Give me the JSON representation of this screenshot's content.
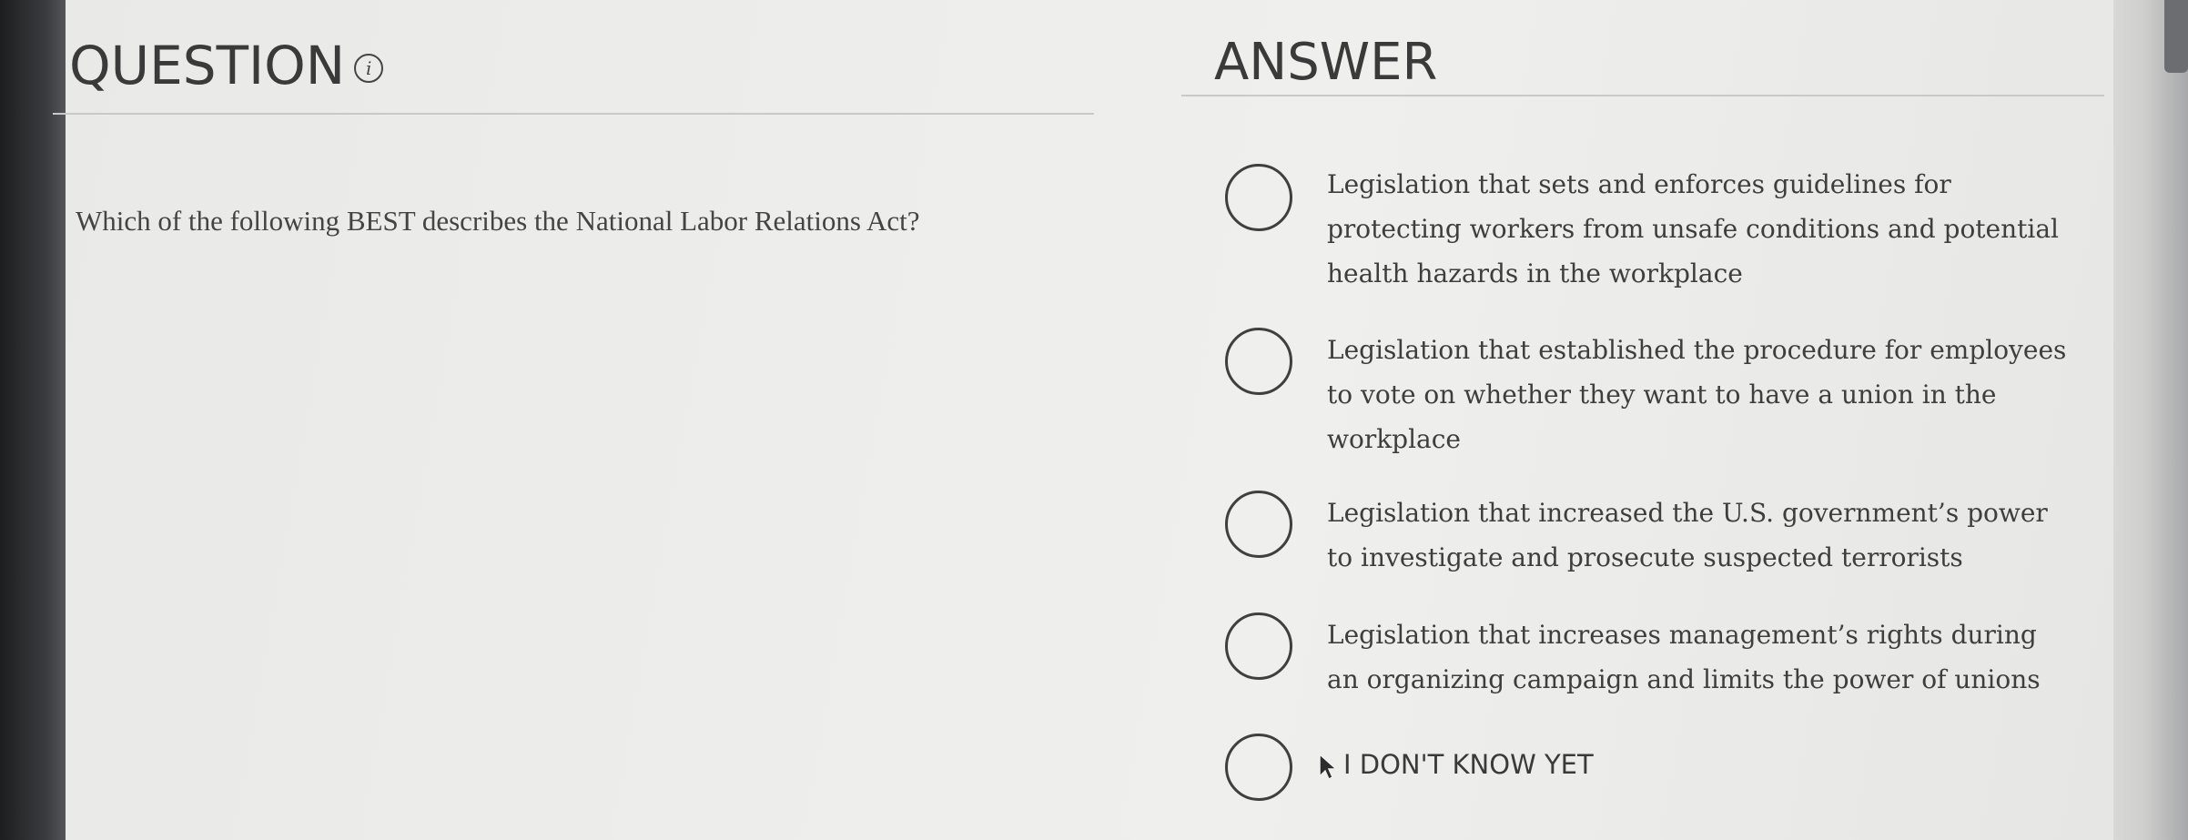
{
  "question_panel": {
    "heading": "QUESTION",
    "info_icon_glyph": "i",
    "text": "Which of the following BEST describes the National Labor Relations Act?"
  },
  "answer_panel": {
    "heading": "ANSWER",
    "options": [
      {
        "label": "Legislation that sets and enforces guidelines for protecting workers from unsafe conditions and potential health hazards in the workplace",
        "selected": false
      },
      {
        "label": "Legislation that established the procedure for employees to vote on whether they want to have a union in the workplace",
        "selected": false
      },
      {
        "label": "Legislation that increased the U.S. government’s power to investigate and prosecute suspected terrorists",
        "selected": false
      },
      {
        "label": "Legislation that increases management’s rights during an organizing campaign and limits the power of unions",
        "selected": false
      },
      {
        "label": "I DON'T KNOW YET",
        "selected": false
      }
    ]
  },
  "icons": {
    "info": "info-circle-icon",
    "cursor": "mouse-cursor-icon"
  }
}
